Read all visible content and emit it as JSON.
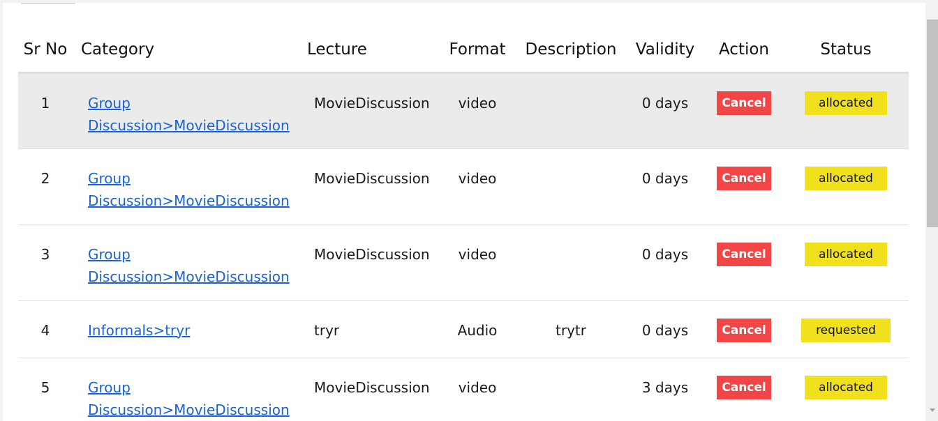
{
  "table": {
    "headers": {
      "sr": "Sr No",
      "category": "Category",
      "lecture": "Lecture",
      "format": "Format",
      "description": "Description",
      "validity": "Validity",
      "action": "Action",
      "status": "Status"
    },
    "rows": [
      {
        "sr": "1",
        "category": "Group Discussion>MovieDiscussion",
        "lecture": "MovieDiscussion",
        "format": "video",
        "description": "",
        "validity": "0 days",
        "action": "Cancel",
        "status": "allocated"
      },
      {
        "sr": "2",
        "category": "Group Discussion>MovieDiscussion",
        "lecture": "MovieDiscussion",
        "format": "video",
        "description": "",
        "validity": "0 days",
        "action": "Cancel",
        "status": "allocated"
      },
      {
        "sr": "3",
        "category": "Group Discussion>MovieDiscussion",
        "lecture": "MovieDiscussion",
        "format": "video",
        "description": "",
        "validity": "0 days",
        "action": "Cancel",
        "status": "allocated"
      },
      {
        "sr": "4",
        "category": "Informals>tryr",
        "lecture": "tryr",
        "format": "Audio",
        "description": "trytr",
        "validity": "0 days",
        "action": "Cancel",
        "status": "requested"
      },
      {
        "sr": "5",
        "category": "Group Discussion>MovieDiscussion",
        "lecture": "MovieDiscussion",
        "format": "video",
        "description": "",
        "validity": "3 days",
        "action": "Cancel",
        "status": "allocated"
      }
    ]
  },
  "colors": {
    "link": "#1a62d6",
    "cancel_button": "#f24646",
    "status_badge": "#f0e11c",
    "shaded_row": "#ebebeb"
  }
}
